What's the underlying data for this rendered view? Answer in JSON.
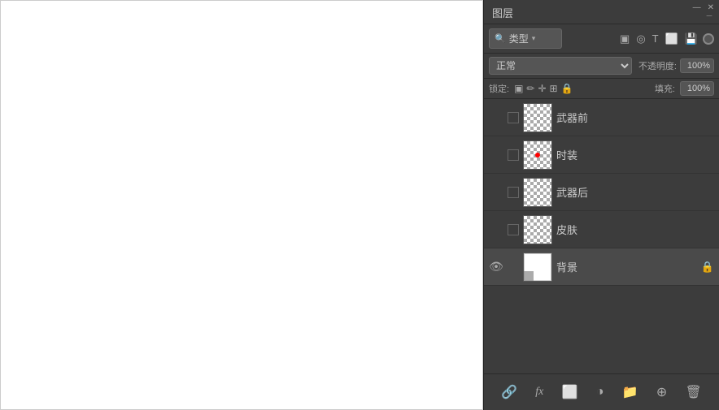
{
  "window": {
    "controls": {
      "minimize": "—",
      "close": "✕"
    }
  },
  "panel": {
    "title": "图层",
    "menu_icon": "≡",
    "filter": {
      "label": "类型",
      "dropdown_arrow": "▾"
    },
    "blend_mode": {
      "value": "正常",
      "arrow": "▾"
    },
    "opacity": {
      "label": "不透明度:",
      "value": "100%"
    },
    "lock": {
      "label": "锁定:"
    },
    "fill": {
      "label": "填充:",
      "value": "100%"
    },
    "layers": [
      {
        "name": "武器前",
        "has_eye": false,
        "thumb_type": "checker",
        "has_lock": false,
        "has_red_dot": false
      },
      {
        "name": "时装",
        "has_eye": false,
        "thumb_type": "checker_red",
        "has_lock": false,
        "has_red_dot": true
      },
      {
        "name": "武器后",
        "has_eye": false,
        "thumb_type": "checker",
        "has_lock": false,
        "has_red_dot": false
      },
      {
        "name": "皮肤",
        "has_eye": false,
        "thumb_type": "checker",
        "has_lock": false,
        "has_red_dot": false
      },
      {
        "name": "背景",
        "has_eye": true,
        "thumb_type": "white",
        "has_lock": true,
        "has_red_dot": false
      }
    ],
    "footer_buttons": [
      {
        "name": "link-icon",
        "symbol": "🔗"
      },
      {
        "name": "fx-icon",
        "symbol": "ƒx"
      },
      {
        "name": "circle-icon",
        "symbol": "⬤"
      },
      {
        "name": "half-circle-icon",
        "symbol": "◑"
      },
      {
        "name": "folder-icon",
        "symbol": "🗁"
      },
      {
        "name": "add-layer-icon",
        "symbol": "⊕"
      },
      {
        "name": "trash-icon",
        "symbol": "🗑"
      }
    ]
  }
}
